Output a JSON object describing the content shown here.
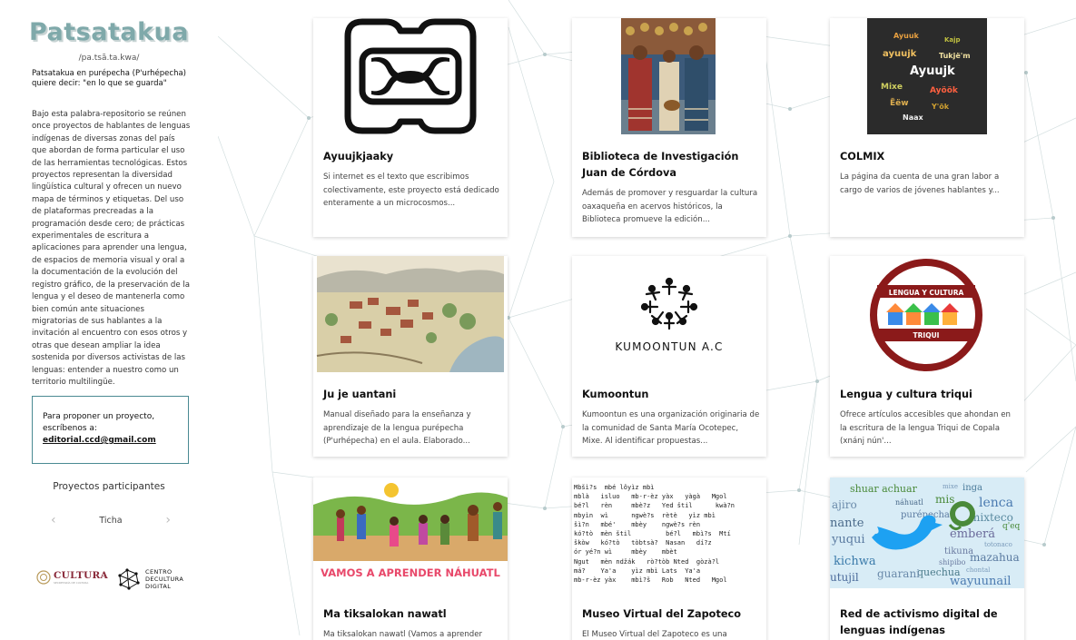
{
  "sidebar": {
    "title": "Patsatakua",
    "pronunciation": "/pa.tsã.ta.kwa/",
    "meaning": "Patsatakua en purépecha (P'urhépecha) quiere decir: \"en lo que se guarda\"",
    "description": "Bajo esta palabra-repositorio se reúnen once proyectos de hablantes de lenguas indígenas de diversas zonas del país que abordan de forma particular el uso de las herramientas tecnológicas. Estos proyectos representan la diversidad lingüística cultural y ofrecen un nuevo mapa de términos y etiquetas. Del uso de plataformas precreadas a la programación desde cero; de prácticas experimentales de escritura a aplicaciones para aprender una lengua, de espacios de memoria visual y oral a la documentación de la evolución del registro gráfico, de la preservación de la lengua y el deseo de mantenerla como bien común ante situaciones migratorias de sus hablantes a la invitación al encuentro con esos otros y otras que desean ampliar la idea sostenida por diversos activistas de las lenguas: entender a nuestro como un territorio multilingüe.",
    "propose_text": "Para proponer un proyecto, escríbenos a:",
    "propose_email": "editorial.ccd@gmail.com",
    "participants_label": "Proyectos participantes",
    "carousel_item": "Ticha",
    "carousel_prev": "‹",
    "carousel_next": "›",
    "logo_cultura": "CULTURA",
    "logo_cultura_sub": "SECRETARÍA DE CULTURA",
    "logo_ccd_line1": "CENTRO",
    "logo_ccd_line2": "DECULTURA",
    "logo_ccd_line3": "DIGITAL"
  },
  "cards": [
    {
      "title": "Ayuujkjaaky",
      "excerpt": "Si internet es el texto que escribimos colectivamente, este proyecto está dedicado enteramente a un microcosmos..."
    },
    {
      "title": "Biblioteca de Investigación Juan de Córdova",
      "excerpt": "Además de promover y resguardar la cultura oaxaqueña en acervos históricos, la Biblioteca promueve la edición..."
    },
    {
      "title": "COLMIX",
      "excerpt": "La página da cuenta de una gran labor a cargo de varios de jóvenes hablantes y..."
    },
    {
      "title": "Ju je uantani",
      "excerpt": "Manual diseñado para la enseñanza y aprendizaje de la lengua purépecha (P'urhépecha) en el aula. Elaborado..."
    },
    {
      "title": "Kumoontun",
      "excerpt": "Kumoontun es una organización originaria de la comunidad de Santa María Ocotepec, Mixe. Al identificar propuestas..."
    },
    {
      "title": "Lengua y cultura triqui",
      "excerpt": "Ofrece artículos accesibles que ahondan en la escritura de la lengua Triqui de Copala (xnánj nún'..."
    },
    {
      "title": "Ma tiksalokan nawatl",
      "excerpt": "Ma tiksalokan nawatl (Vamos a aprender"
    },
    {
      "title": "Museo Virtual del Zapoteco",
      "excerpt": "El Museo Virtual del Zapoteco es una"
    },
    {
      "title": "Red de activismo digital de lenguas indígenas",
      "excerpt": ""
    }
  ],
  "thumbs": {
    "kumoontun_label": "KUMOONTUN A.C",
    "triqui_label_top": "LENGUA Y CULTURA",
    "triqui_label_bottom": "TRIQUI",
    "nahuatl_banner": "VAMOS A APRENDER NÁHUATL",
    "colmix_words": [
      "Ayuuk",
      "ayuujk",
      "Ayuujk",
      "Mixe",
      "Ayöök",
      "Tukjë'm",
      "Ëëw",
      "Y'ök",
      "Naax",
      "Kajp"
    ],
    "zapoteco_text": "Mbšì?s  mbé lôyìz mbì\nmblà   isluo   mb-r-èz yàx   yàgà   Mgol\nbé?l   rèn     mbè?z   Yed štil      kwà?n\nmbyìn  wì      ngwè?s  rètè   yìz mbì\nšì?n   mbé'    mbèy    ngwè?s rèn\nkó?tò  mèn štil         bé?l   mbì?s  Mtí\nškòw   kó?tò   tòbtsà?  Nasan   dí?z\nór yé?n wì     mbèy    mbèt\nNgut   mèn ndžák   rò?tòb Nted  gòzà?l\nmá?    Ya'a    yìz mbì Lats  Ya'a\nmb-r-èz yàx    mbì?š   Rob   Nted   Mgol",
    "red_words": [
      "shuar achuar",
      "inga",
      "mixe",
      "ajiro",
      "náhuatl",
      "mis",
      "lenca",
      "nante",
      "purépecha",
      "mixteco",
      "yuqui",
      "emberá",
      "tikuna",
      "kichwa",
      "shipibo",
      "mazahua",
      "utujil",
      "quechua",
      "guarani",
      "wayuunail",
      "totonaco",
      "chontal",
      "q'eq"
    ]
  },
  "colors": {
    "accent": "#7fa9aa",
    "box_border": "#4a8a92",
    "cultura": "#8a2a3a",
    "triqui_red": "#8b1a1a"
  }
}
